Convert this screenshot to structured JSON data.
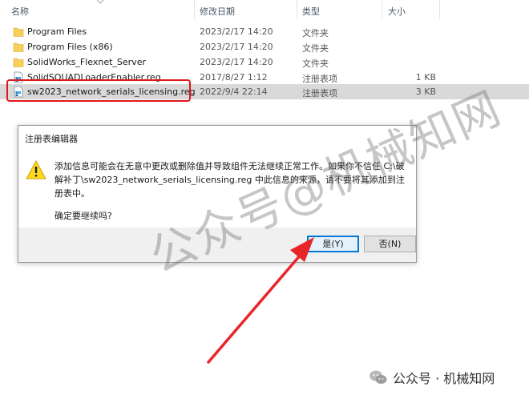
{
  "header": {
    "name": "名称",
    "date": "修改日期",
    "type": "类型",
    "size": "大小"
  },
  "files": [
    {
      "name": "Program Files",
      "date": "2023/2/17 14:20",
      "type": "文件夹",
      "size": "",
      "kind": "folder"
    },
    {
      "name": "Program Files (x86)",
      "date": "2023/2/17 14:20",
      "type": "文件夹",
      "size": "",
      "kind": "folder"
    },
    {
      "name": "SolidWorks_Flexnet_Server",
      "date": "2023/2/17 14:20",
      "type": "文件夹",
      "size": "",
      "kind": "folder"
    },
    {
      "name": "SolidSQUADLoaderEnabler.reg",
      "date": "2017/8/27 1:12",
      "type": "注册表项",
      "size": "1 KB",
      "kind": "reg"
    },
    {
      "name": "sw2023_network_serials_licensing.reg",
      "date": "2022/9/4 22:14",
      "type": "注册表项",
      "size": "3 KB",
      "kind": "reg",
      "selected": true
    }
  ],
  "dialog": {
    "title": "注册表编辑器",
    "message": "添加信息可能会在无意中更改或删除值并导致组件无法继续正常工作。如果你不信任 C:\\破解补丁\\sw2023_network_serials_licensing.reg 中此信息的来源，请不要将其添加到注册表中。",
    "confirm": "确定要继续吗?",
    "yes_label": "是(Y)",
    "no_label": "否(N)"
  },
  "watermark": "公众号@机械知网",
  "footer_mark": "公众号 · 机械知网",
  "colors": {
    "highlight": "#e0161b",
    "arrow": "#e8262a",
    "accent": "#0078d7"
  }
}
